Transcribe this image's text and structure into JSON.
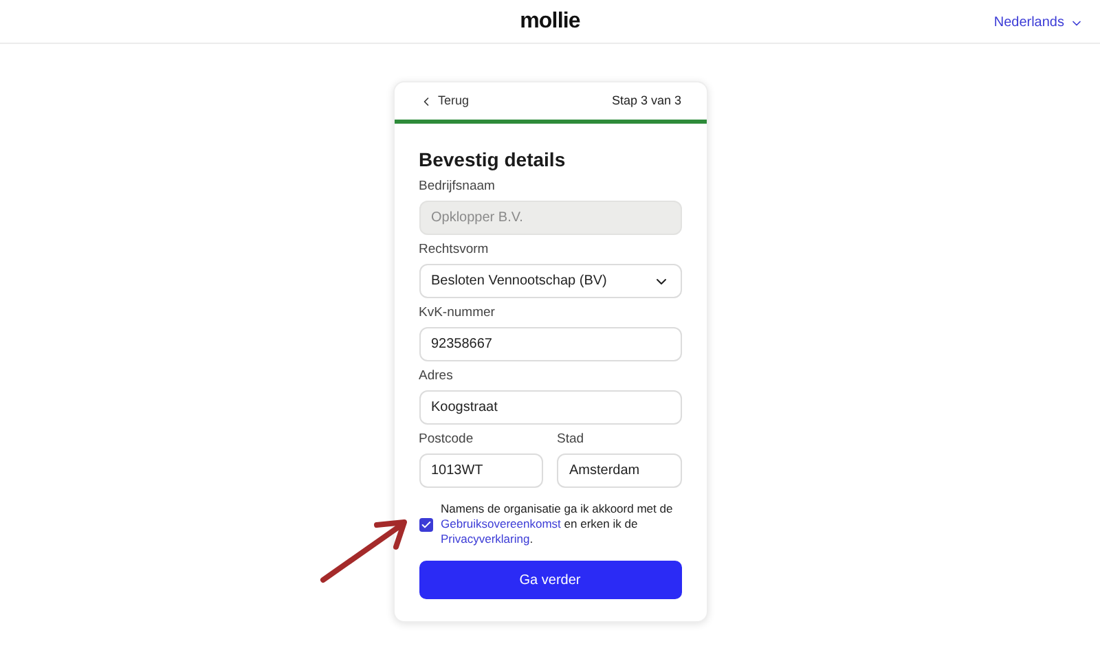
{
  "header": {
    "logo": "mollie",
    "language": "Nederlands"
  },
  "card": {
    "back": "Terug",
    "step": "Stap 3 van 3",
    "progress": {
      "level": 1
    },
    "title": "Bevestig details",
    "rows": [
      [
        {
          "label": "Bedrijfsnaam",
          "kind": "text",
          "value": "Opklopper B.V.",
          "disabled": true
        }
      ],
      [
        {
          "label": "Rechtsvorm",
          "kind": "select",
          "value": "Besloten Vennootschap (BV)",
          "disabled": false
        }
      ],
      [
        {
          "label": "KvK-nummer",
          "kind": "text",
          "value": "92358667",
          "disabled": false
        }
      ],
      [
        {
          "label": "Adres",
          "kind": "text",
          "value": "Koogstraat",
          "disabled": false
        }
      ],
      [
        {
          "label": "Postcode",
          "kind": "text",
          "value": "1013WT",
          "disabled": false
        },
        {
          "label": "Stad",
          "kind": "text",
          "value": "Amsterdam",
          "disabled": false
        }
      ]
    ],
    "consent": {
      "checked": true,
      "before": "Namens de organisatie ga ik akkoord met de",
      "link_1": "Gebruiksovereenkomst",
      "middle": "en erken ik de",
      "link_2": "Privacyverklaring",
      "after": "."
    },
    "submit": "Ga verder"
  }
}
